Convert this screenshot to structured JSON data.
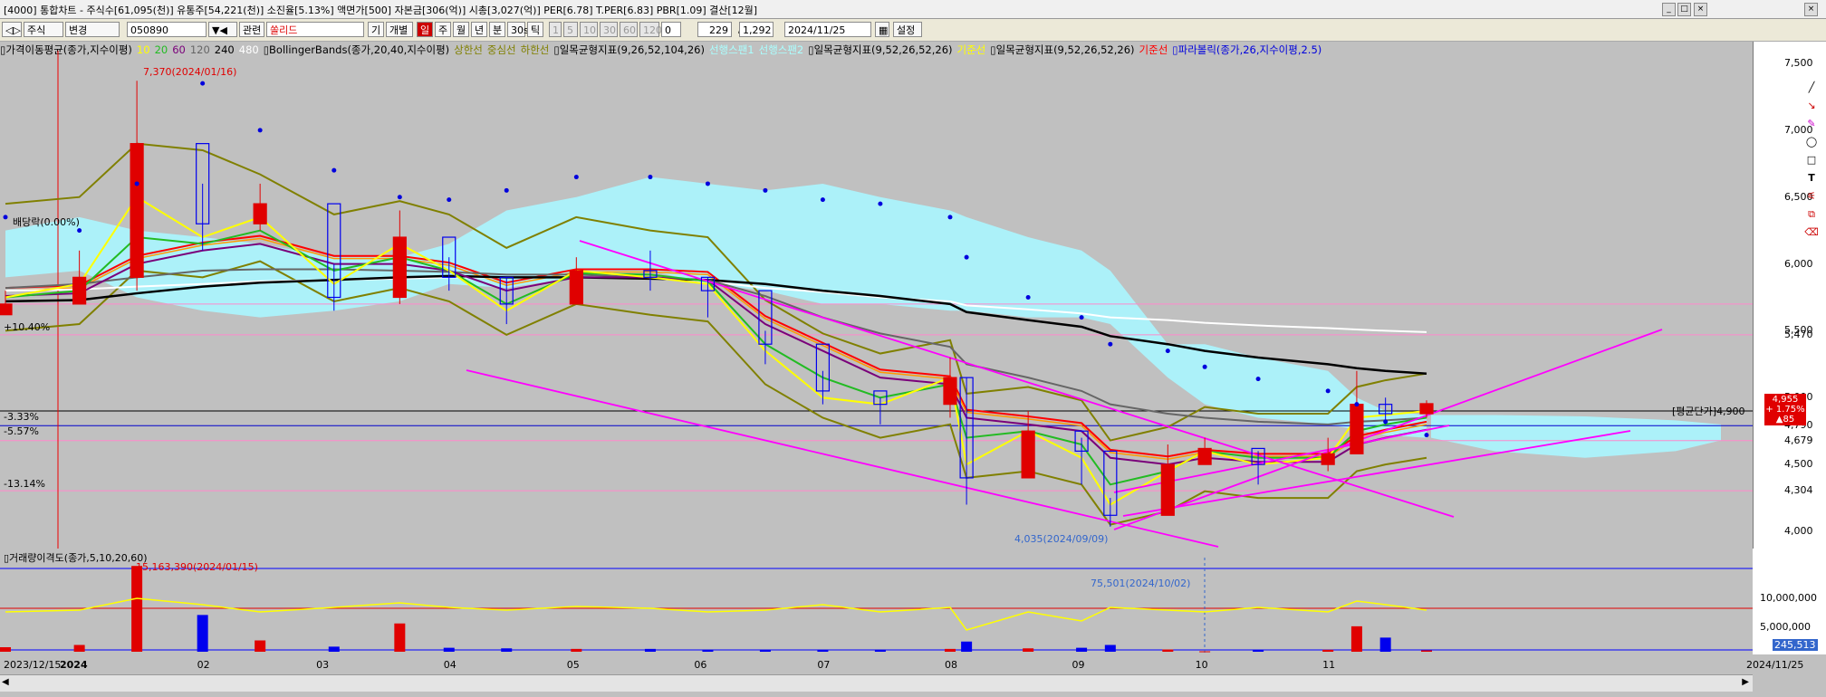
{
  "window": {
    "title": "[4000] 통합차트 - 주식수[61,095(천)] 유통주[54,221(천)] 소진율[5.13%] 액면가[500] 자본금[306(억)] 시총[3,027(억)] PER[6.78] T.PER[6.83] PBR[1.09] 결산[12월]"
  },
  "toolbar": {
    "market": "주식",
    "change_label": "변경",
    "code": "050890",
    "related_label": "관련",
    "stock_name": "쏠리드",
    "btn_gi": "기",
    "btn_gaebyeol": "개별",
    "period_day": "일",
    "period_week": "주",
    "period_month": "월",
    "period_year": "년",
    "period_min": "분",
    "period_30s": "30s",
    "period_tick": "틱",
    "interval_options": [
      "1",
      "5",
      "10",
      "30",
      "60",
      "120"
    ],
    "interval_input": "0",
    "count": "229",
    "count_total": "1,292",
    "date": "2024/11/25",
    "settings_label": "설정"
  },
  "legend": [
    {
      "text": "가격이동평균(종가,지수이평)",
      "color": "#000000"
    },
    {
      "text": "10",
      "color": "#ffff00"
    },
    {
      "text": "20",
      "color": "#22bb22"
    },
    {
      "text": "60",
      "color": "#7a007a"
    },
    {
      "text": "120",
      "color": "#666666"
    },
    {
      "text": "240",
      "color": "#000000"
    },
    {
      "text": "480",
      "color": "#ffffff"
    },
    {
      "text": "BollingerBands(종가,20,40,지수이평)",
      "color": "#000000"
    },
    {
      "text": "상한선",
      "color": "#808000"
    },
    {
      "text": "중심선",
      "color": "#808000"
    },
    {
      "text": "하한선",
      "color": "#808000"
    },
    {
      "text": "일목균형지표(9,26,52,104,26)",
      "color": "#000000"
    },
    {
      "text": "선행스팬1",
      "color": "#aaffff"
    },
    {
      "text": "선행스팬2",
      "color": "#aaffff"
    },
    {
      "text": "일목균형지표(9,52,26,52,26)",
      "color": "#000000"
    },
    {
      "text": "기준선",
      "color": "#ffff00"
    },
    {
      "text": "일목균형지표(9,52,26,52,26)",
      "color": "#000000"
    },
    {
      "text": "기준선",
      "color": "#ff0000"
    },
    {
      "text": "파라볼릭(종가,26,지수이평,2.5)",
      "color": "#0000dd"
    }
  ],
  "price_axis": {
    "ticks": [
      "7,500",
      "7,000",
      "6,500",
      "6,000",
      "5,500",
      "5,000",
      "4,500",
      "4,000"
    ]
  },
  "volume_axis": {
    "ticks": [
      "10,000,000",
      "5,000,000"
    ]
  },
  "x_axis": {
    "start_label": "2023/12/15",
    "year_label": "2024",
    "months": [
      "02",
      "03",
      "04",
      "05",
      "06",
      "07",
      "08",
      "09",
      "10",
      "11"
    ],
    "end_label": "2024/11/25"
  },
  "annotations": {
    "high": "7,370(2024/01/16)",
    "low": "4,035(2024/09/09)",
    "dividend": "배당락(0.00%)",
    "pct_top": "+10.40%",
    "pct_1": "-3.33%",
    "pct_2": "-5.57%",
    "pct_3": "-13.14%",
    "avg_price_label": "[평균단가]",
    "avg_price": "4,900",
    "level_5470": "5,470",
    "level_4790": "4,790",
    "level_4679": "4,679",
    "level_4304": "4,304",
    "current_price": "4,955",
    "current_change_pct": "+ 1.75%",
    "current_change": "▲85",
    "vol_indicator": "거래량이격도(종가,5,10,20,60)",
    "vol_max": "15,163,390(2024/01/15)",
    "vol_point": "75,501(2024/10/02)",
    "vol_current": "245,513"
  },
  "chart_data": {
    "type": "candlestick",
    "title": "쏠리드 050890",
    "ylim": [
      3850,
      7650
    ],
    "x": [
      "2023-12-15",
      "2024-01-02",
      "2024-01-16",
      "2024-02-01",
      "2024-02-15",
      "2024-03-04",
      "2024-03-20",
      "2024-04-01",
      "2024-04-15",
      "2024-05-02",
      "2024-05-20",
      "2024-06-03",
      "2024-06-17",
      "2024-07-01",
      "2024-07-15",
      "2024-08-01",
      "2024-08-05",
      "2024-08-20",
      "2024-09-02",
      "2024-09-09",
      "2024-09-23",
      "2024-10-02",
      "2024-10-15",
      "2024-11-01",
      "2024-11-08",
      "2024-11-15",
      "2024-11-25"
    ],
    "close": [
      5700,
      5900,
      6900,
      6300,
      6450,
      5750,
      6200,
      5900,
      5700,
      5950,
      5900,
      5800,
      5400,
      5050,
      4950,
      5150,
      4400,
      4750,
      4600,
      4120,
      4500,
      4620,
      4500,
      4580,
      4950,
      4880,
      4955
    ],
    "high": [
      5800,
      6100,
      7370,
      6600,
      6600,
      6000,
      6400,
      6050,
      5900,
      6050,
      6100,
      5900,
      5500,
      5200,
      5000,
      5300,
      5150,
      4900,
      4700,
      4250,
      4650,
      4700,
      4600,
      4700,
      5200,
      5000,
      4980
    ],
    "low": [
      5650,
      5700,
      5800,
      6100,
      6250,
      5650,
      5700,
      5800,
      5550,
      5850,
      5800,
      5600,
      5250,
      4950,
      4800,
      4850,
      4200,
      4550,
      4350,
      4035,
      4350,
      4550,
      4350,
      4450,
      4650,
      4800,
      4850
    ],
    "moving_averages": {
      "10": [
        5750,
        5850,
        6500,
        6200,
        6350,
        5850,
        6150,
        5950,
        5650,
        5950,
        5900,
        5850,
        5350,
        5000,
        4950,
        5150,
        4500,
        4750,
        4550,
        4200,
        4450,
        4600,
        4500,
        4550,
        4850,
        4870,
        4900
      ],
      "20": [
        5750,
        5800,
        6200,
        6150,
        6250,
        5950,
        6050,
        5950,
        5700,
        5930,
        5920,
        5870,
        5400,
        5150,
        5000,
        5100,
        4700,
        4750,
        4650,
        4350,
        4450,
        4600,
        4550,
        4550,
        4750,
        4800,
        4850
      ],
      "60": [
        5760,
        5780,
        6000,
        6100,
        6150,
        6000,
        6000,
        5950,
        5800,
        5900,
        5900,
        5880,
        5550,
        5350,
        5150,
        5100,
        4850,
        4800,
        4750,
        4550,
        4500,
        4550,
        4520,
        4520,
        4650,
        4700,
        4760
      ],
      "120": [
        5820,
        5850,
        5900,
        5950,
        5960,
        5960,
        5950,
        5940,
        5920,
        5920,
        5900,
        5880,
        5760,
        5600,
        5480,
        5380,
        5250,
        5150,
        5050,
        4950,
        4880,
        4850,
        4820,
        4800,
        4820,
        4830,
        4850
      ],
      "240": [
        5720,
        5730,
        5780,
        5830,
        5860,
        5880,
        5900,
        5910,
        5900,
        5900,
        5890,
        5880,
        5850,
        5800,
        5760,
        5700,
        5640,
        5580,
        5530,
        5460,
        5400,
        5350,
        5300,
        5250,
        5220,
        5200,
        5180
      ],
      "480": [
        5800,
        5810,
        5830,
        5850,
        5870,
        5880,
        5890,
        5900,
        5900,
        5900,
        5890,
        5870,
        5820,
        5790,
        5750,
        5720,
        5690,
        5660,
        5630,
        5600,
        5580,
        5560,
        5540,
        5520,
        5510,
        5500,
        5490
      ]
    },
    "parabolic_sar": [
      6350,
      6250,
      6600,
      7350,
      7000,
      6700,
      6500,
      6480,
      6550,
      6650,
      6650,
      6600,
      6550,
      6480,
      6450,
      6350,
      6050,
      5750,
      5600,
      5400,
      5350,
      5230,
      5140,
      5050,
      4950,
      4820,
      4720
    ],
    "volume": [
      800000,
      1200000,
      15163390,
      6500000,
      2000000,
      900000,
      5000000,
      700000,
      600000,
      500000,
      500000,
      400000,
      350000,
      350000,
      400000,
      500000,
      1800000,
      600000,
      700000,
      1200000,
      400000,
      75501,
      300000,
      350000,
      4500000,
      2500000,
      245513
    ]
  },
  "colors": {
    "bg": "#c0c0c0",
    "up": "#e00000",
    "down": "#0000ee",
    "ma10": "#ffff00",
    "ma20": "#22bb22",
    "ma60": "#7a007a",
    "ma120": "#666666",
    "ma240": "#000000",
    "ma480": "#ffffff",
    "bollinger": "#808000",
    "cloud": "#aaf6ff",
    "kijun_y": "#ffff00",
    "kijun_r": "#ff0000",
    "parabolic": "#0000dd",
    "trend": "#ff00ff"
  }
}
